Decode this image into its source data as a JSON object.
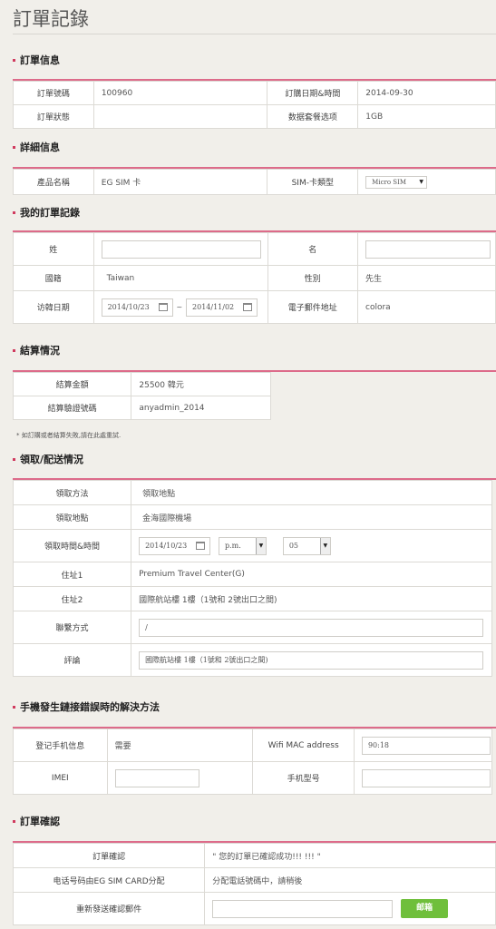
{
  "page_title": "訂單記錄",
  "sections": {
    "order_info": "訂單信息",
    "detail_info": "詳細信息",
    "my_record": "我的訂單記錄",
    "settlement": "結算情況",
    "pickup": "領取/配送情況",
    "troubleshoot": "手機發生鏈接錯誤時的解決方法",
    "confirm": "訂單確認"
  },
  "order": {
    "no_label": "訂單號碼",
    "no_value": "100960",
    "date_label": "訂購日期&時間",
    "date_value": "2014-09-30",
    "status_label": "訂單狀態",
    "status_value": "",
    "plan_label": "数据套餐选项",
    "plan_value": "1GB"
  },
  "detail": {
    "product_label": "產品名稱",
    "product_value": "EG SIM 卡",
    "sim_label": "SIM-卡類型",
    "sim_value": "Micro SIM"
  },
  "record": {
    "surname_label": "姓",
    "surname_value": "",
    "name_label": "名",
    "name_value": "",
    "nationality_label": "國籍",
    "nationality_value": "Taiwan",
    "gender_label": "性別",
    "gender_value": "先生",
    "visit_label": "访韓日期",
    "visit_from": "2014/10/23",
    "visit_sep": "~",
    "visit_to": "2014/11/02",
    "email_label": "電子郵件地址",
    "email_value": "colora"
  },
  "settlement": {
    "amount_label": "結算金額",
    "amount_value": "25500 韓元",
    "code_label": "結算驗證號碼",
    "code_value": "anyadmin_2014",
    "note": "* 如訂購或者結算失敗,請在此處重試."
  },
  "pickup": {
    "method_label": "領取方法",
    "method_value": "領取地點",
    "place_label": "領取地點",
    "place_value": "金海國際機場",
    "datetime_label": "領取時間&時間",
    "date_value": "2014/10/23",
    "ampm_value": "p.m.",
    "hour_value": "05",
    "addr1_label": "住址1",
    "addr1_value": "Premium Travel Center(G)",
    "addr2_label": "住址2",
    "addr2_value": "國際航站樓 1樓（1號和 2號出口之間)",
    "contact_label": "聯繫方式",
    "contact_value": "/",
    "comment_label": "評論",
    "comment_value": "國際航站樓 1樓（1號和 2號出口之間)"
  },
  "trouble": {
    "register_label": "登记手机信息",
    "register_value": "需要",
    "mac_label": "Wifi MAC address",
    "mac_value": "90:18",
    "imei_label": "IMEI",
    "imei_value": "",
    "model_label": "手机型号",
    "model_value": ""
  },
  "confirm": {
    "confirm_label": "訂單確認",
    "confirm_value": "\" 您的訂單已確認成功!!! !!! \"",
    "phone_label": "电话号码由EG SIM CARD分配",
    "phone_value": "分配電話號碼中，請稍後",
    "resend_label": "重新發送確認郵件",
    "resend_value": "",
    "mail_button": "邮箱"
  },
  "colors": {
    "accent": "#dd6b8a",
    "button": "#6fbf3b",
    "background": "#f1efea"
  }
}
